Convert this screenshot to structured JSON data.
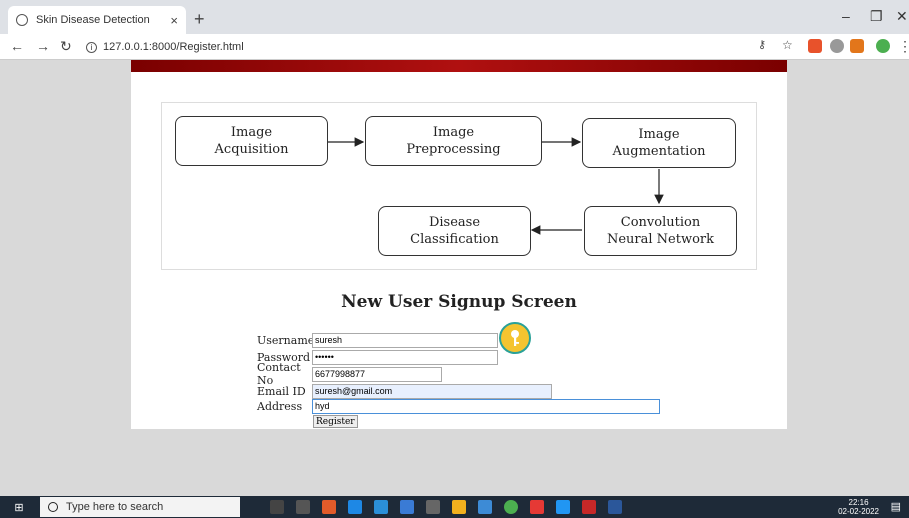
{
  "browser": {
    "tab_title": "Skin Disease Detection",
    "tab_close": "×",
    "new_tab": "+",
    "url": "127.0.0.1:8000/Register.html"
  },
  "diagram": {
    "nodes": [
      {
        "id": "acq",
        "text_line1": "Image",
        "text_line2": "Acquisition"
      },
      {
        "id": "pre",
        "text_line1": "Image",
        "text_line2": "Preprocessing"
      },
      {
        "id": "aug",
        "text_line1": "Image",
        "text_line2": "Augmentation"
      },
      {
        "id": "cnn",
        "text_line1": "Convolution",
        "text_line2": "Neural Network"
      },
      {
        "id": "cls",
        "text_line1": "Disease",
        "text_line2": "Classification"
      }
    ]
  },
  "form": {
    "title": "New User Signup Screen",
    "username_label": "Username",
    "username_value": "suresh",
    "password_label": "Password",
    "password_value": "••••••",
    "contact_label": "Contact No",
    "contact_value": "6677998877",
    "email_label": "Email ID",
    "email_value": "suresh@gmail.com",
    "address_label": "Address",
    "address_value": "hyd",
    "register_label": "Register"
  },
  "taskbar": {
    "search_placeholder": "Type here to search",
    "time": "22:16",
    "date": "02-02-2022"
  }
}
